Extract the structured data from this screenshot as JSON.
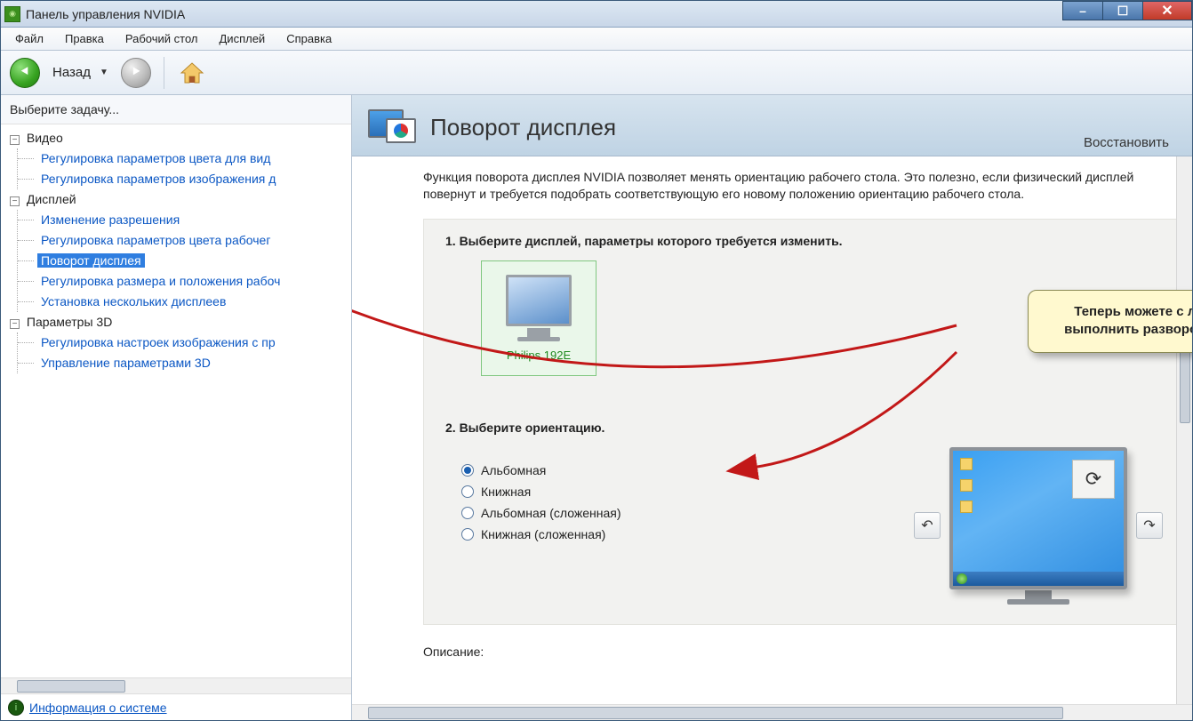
{
  "window": {
    "title": "Панель управления NVIDIA"
  },
  "menu": {
    "file": "Файл",
    "edit": "Правка",
    "desktop": "Рабочий стол",
    "display": "Дисплей",
    "help": "Справка"
  },
  "toolbar": {
    "back": "Назад"
  },
  "sidebar": {
    "title": "Выберите задачу...",
    "nodes": {
      "video": "Видео",
      "video_items": [
        "Регулировка параметров цвета для вид",
        "Регулировка параметров изображения д"
      ],
      "display": "Дисплей",
      "display_items": [
        "Изменение разрешения",
        "Регулировка параметров цвета рабочег",
        "Поворот дисплея",
        "Регулировка размера и положения рабоч",
        "Установка нескольких дисплеев"
      ],
      "params3d": "Параметры 3D",
      "params3d_items": [
        "Регулировка настроек изображения с пр",
        "Управление параметрами 3D"
      ]
    },
    "selected_index": 2,
    "sysinfo": "Информация о системе"
  },
  "content": {
    "title": "Поворот дисплея",
    "restore": "Восстановить",
    "description": "Функция поворота дисплея NVIDIA позволяет менять ориентацию рабочего стола. Это полезно, если физический дисплей повернут и требуется подобрать соответствующую его новому положению ориентацию рабочего стола.",
    "step1_title": "1. Выберите дисплей, параметры которого требуется изменить.",
    "display_name": "Philips 192E",
    "step2_title": "2. Выберите ориентацию.",
    "orientations": [
      "Альбомная",
      "Книжная",
      "Альбомная (сложенная)",
      "Книжная (сложенная)"
    ],
    "orientation_checked": 0,
    "desc_label": "Описание:"
  },
  "callout": {
    "text": "Теперь можете с легкостью выполнить разворот десплея!"
  }
}
